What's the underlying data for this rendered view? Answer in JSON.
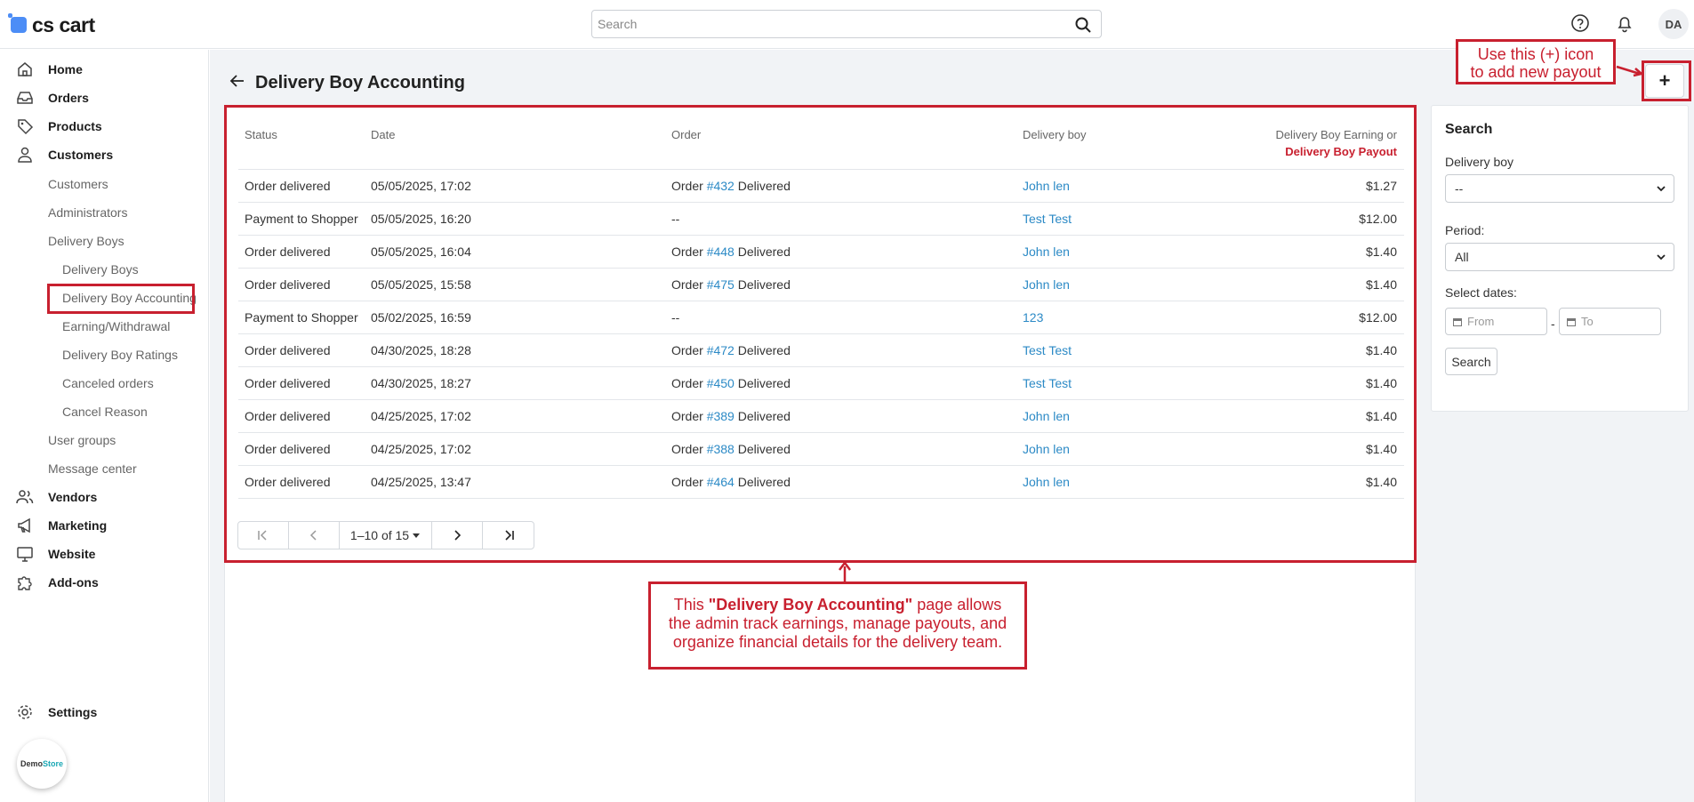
{
  "header": {
    "logo_text": "cs cart",
    "search_placeholder": "Search",
    "avatar_initials": "DA"
  },
  "sidebar": {
    "items": [
      {
        "label": "Home",
        "icon": "home-icon"
      },
      {
        "label": "Orders",
        "icon": "inbox-icon"
      },
      {
        "label": "Products",
        "icon": "tag-icon"
      },
      {
        "label": "Customers",
        "icon": "user-icon"
      },
      {
        "label": "Customers"
      },
      {
        "label": "Administrators"
      },
      {
        "label": "Delivery Boys"
      },
      {
        "label": "Delivery Boys"
      },
      {
        "label": "Delivery Boy Accounting"
      },
      {
        "label": "Earning/Withdrawal"
      },
      {
        "label": "Delivery Boy Ratings"
      },
      {
        "label": "Canceled orders"
      },
      {
        "label": "Cancel Reason"
      },
      {
        "label": "User groups"
      },
      {
        "label": "Message center"
      },
      {
        "label": "Vendors",
        "icon": "users-icon"
      },
      {
        "label": "Marketing",
        "icon": "megaphone-icon"
      },
      {
        "label": "Website",
        "icon": "monitor-icon"
      },
      {
        "label": "Add-ons",
        "icon": "puzzle-icon"
      },
      {
        "label": "Settings",
        "icon": "gear-icon"
      }
    ],
    "demo_badge": {
      "part1": "Demo",
      "part2": "Store"
    }
  },
  "page": {
    "title": "Delivery Boy Accounting"
  },
  "table": {
    "headers": {
      "status": "Status",
      "date": "Date",
      "order": "Order",
      "delivery_boy": "Delivery boy",
      "earning_line1": "Delivery Boy Earning or",
      "earning_line2": "Delivery Boy Payout"
    },
    "rows": [
      {
        "status": "Order delivered",
        "date": "05/05/2025, 17:02",
        "order_prefix": "Order",
        "order_num": "#432",
        "order_suffix": "Delivered",
        "boy": "John len",
        "amount": "$1.27"
      },
      {
        "status": "Payment to Shopper",
        "date": "05/05/2025, 16:20",
        "order_prefix": "--",
        "order_num": "",
        "order_suffix": "",
        "boy": "Test Test",
        "amount": "$12.00"
      },
      {
        "status": "Order delivered",
        "date": "05/05/2025, 16:04",
        "order_prefix": "Order",
        "order_num": "#448",
        "order_suffix": "Delivered",
        "boy": "John len",
        "amount": "$1.40"
      },
      {
        "status": "Order delivered",
        "date": "05/05/2025, 15:58",
        "order_prefix": "Order",
        "order_num": "#475",
        "order_suffix": "Delivered",
        "boy": "John len",
        "amount": "$1.40"
      },
      {
        "status": "Payment to Shopper",
        "date": "05/02/2025, 16:59",
        "order_prefix": "--",
        "order_num": "",
        "order_suffix": "",
        "boy": "123",
        "amount": "$12.00"
      },
      {
        "status": "Order delivered",
        "date": "04/30/2025, 18:28",
        "order_prefix": "Order",
        "order_num": "#472",
        "order_suffix": "Delivered",
        "boy": "Test Test",
        "amount": "$1.40"
      },
      {
        "status": "Order delivered",
        "date": "04/30/2025, 18:27",
        "order_prefix": "Order",
        "order_num": "#450",
        "order_suffix": "Delivered",
        "boy": "Test Test",
        "amount": "$1.40"
      },
      {
        "status": "Order delivered",
        "date": "04/25/2025, 17:02",
        "order_prefix": "Order",
        "order_num": "#389",
        "order_suffix": "Delivered",
        "boy": "John len",
        "amount": "$1.40"
      },
      {
        "status": "Order delivered",
        "date": "04/25/2025, 17:02",
        "order_prefix": "Order",
        "order_num": "#388",
        "order_suffix": "Delivered",
        "boy": "John len",
        "amount": "$1.40"
      },
      {
        "status": "Order delivered",
        "date": "04/25/2025, 13:47",
        "order_prefix": "Order",
        "order_num": "#464",
        "order_suffix": "Delivered",
        "boy": "John len",
        "amount": "$1.40"
      }
    ],
    "pagination": {
      "range": "1–10 of 15",
      "first_icon": "first-page-icon",
      "prev_icon": "chevron-left-icon",
      "next_icon": "chevron-right-icon",
      "last_icon": "last-page-icon"
    }
  },
  "filters": {
    "title": "Search",
    "delivery_boy_label": "Delivery boy",
    "delivery_boy_value": "--",
    "period_label": "Period:",
    "period_value": "All",
    "dates_label": "Select dates:",
    "from_placeholder": "From",
    "dates_separator": "-",
    "to_placeholder": "To",
    "search_button": "Search"
  },
  "annotations": {
    "tip_line1": "Use this (+) icon",
    "tip_line2": "to add new payout",
    "note_pre": "This ",
    "note_bold": "\"Delivery Boy Accounting\"",
    "note_line1_post": " page allows",
    "note_line2": "the admin track earnings, manage payouts, and",
    "note_line3": "organize financial details for the delivery team.",
    "add_button": "+"
  },
  "colors": {
    "annotation_red": "#c8202f",
    "link_blue": "#2c8ac6",
    "logo_blue": "#4c8df6"
  }
}
